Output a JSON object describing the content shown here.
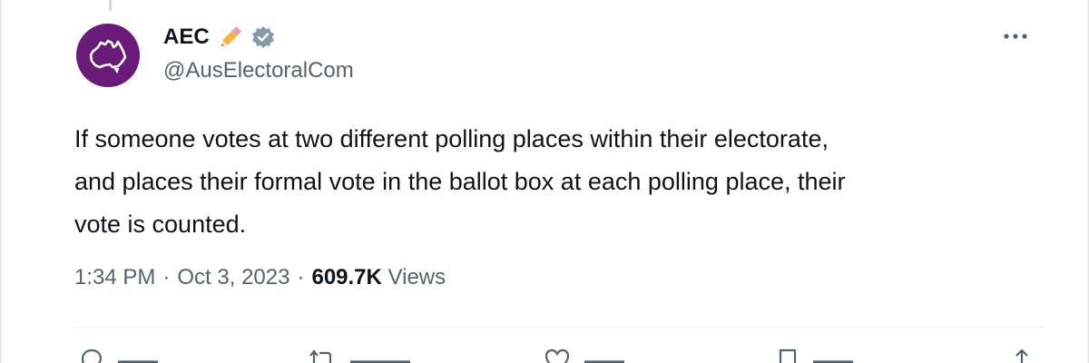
{
  "author": {
    "name": "AEC",
    "emoji": "✏️",
    "handle": "@AusElectoralCom",
    "verified": true,
    "avatar_color": "#6a1b7a"
  },
  "tweet": {
    "text": "If someone votes at two different polling places within their electorate,\nand places their formal vote in the ballot box at each polling place, their\nvote is counted."
  },
  "meta": {
    "time": "1:34 PM",
    "separator": "·",
    "date": "Oct 3, 2023",
    "views_count": "609.7K",
    "views_label": "Views"
  },
  "actions": {
    "reply_icon": "reply-icon",
    "retweet_icon": "retweet-icon",
    "like_icon": "like-icon",
    "bookmark_icon": "bookmark-icon",
    "share_icon": "share-icon"
  },
  "colors": {
    "text_primary": "#0f1419",
    "text_secondary": "#536471",
    "verified_badge": "#829aab"
  }
}
